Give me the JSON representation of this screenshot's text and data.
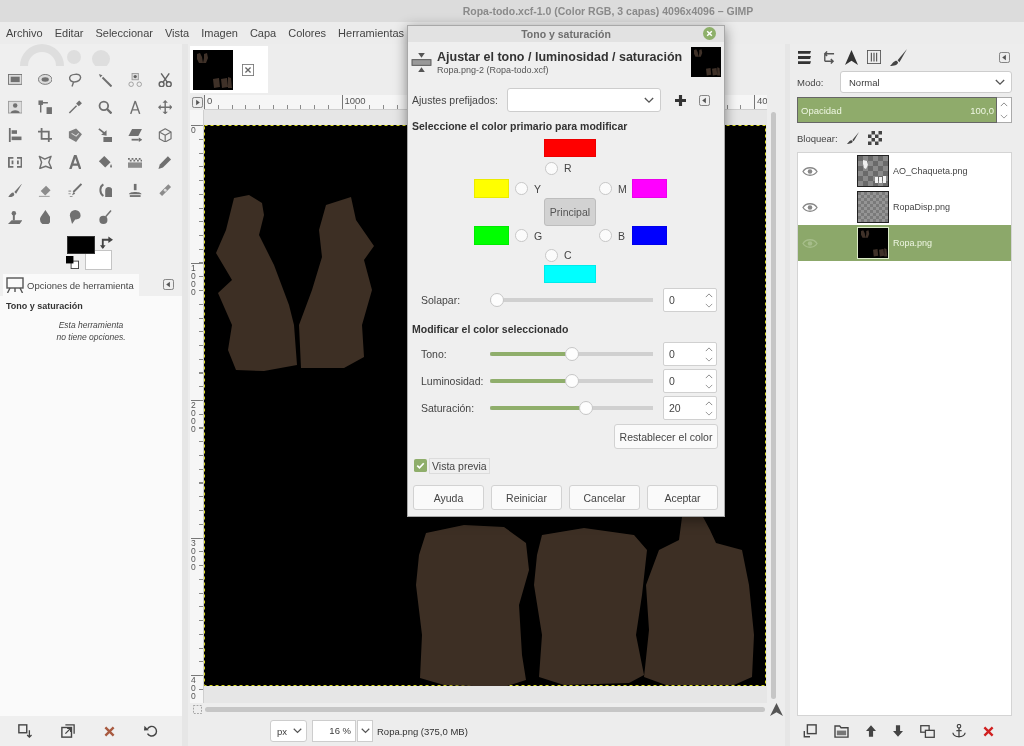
{
  "window": {
    "title": "Ropa-todo.xcf-1.0 (Color RGB, 3 capas) 4096x4096 – GIMP"
  },
  "menu": [
    "Archivo",
    "Editar",
    "Seleccionar",
    "Vista",
    "Imagen",
    "Capa",
    "Colores",
    "Herramientas"
  ],
  "tool_options": {
    "tab": "Opciones de herramienta",
    "tool": "Tono y saturación",
    "message": "Esta herramienta\nno tiene opciones."
  },
  "rulers": {
    "horizontal": [
      "0",
      "1000",
      "40"
    ],
    "vertical": [
      "0",
      "1000",
      "2000",
      "3000",
      "400"
    ]
  },
  "status_bar": {
    "unit": "px",
    "zoom": "16 %",
    "info": "Ropa.png (375,0 MB)"
  },
  "layers_panel": {
    "mode_label": "Modo:",
    "mode": "Normal",
    "opacity": {
      "label": "Opacidad",
      "reading": "100,0",
      "level": 1
    },
    "lock_label": "Bloquear:",
    "layers": [
      {
        "name": "AO_Chaqueta.png",
        "visible": true,
        "selected": false
      },
      {
        "name": "RopaDisp.png",
        "visible": true,
        "selected": false
      },
      {
        "name": "Ropa.png",
        "visible": true,
        "selected": true
      }
    ]
  },
  "dialog": {
    "title": "Tono y saturación",
    "heading": "Ajustar el tono / luminosidad / saturación",
    "subheading": "Ropa.png-2 (Ropa-todo.xcf)",
    "presets_label": "Ajustes prefijados:",
    "primary_heading": "Seleccione el color primario para modificar",
    "primaries": [
      {
        "label": "R",
        "color": "#ff0000",
        "selected": false
      },
      {
        "label": "Y",
        "color": "#ffff00",
        "selected": false
      },
      {
        "label": "M",
        "color": "#ff00ff",
        "selected": false
      },
      {
        "label": "G",
        "color": "#00ff00",
        "selected": false
      },
      {
        "label": "B",
        "color": "#0000ff",
        "selected": false
      },
      {
        "label": "C",
        "color": "#00ffff",
        "selected": false
      }
    ],
    "master": {
      "label": "Principal",
      "selected": true
    },
    "overlap": {
      "label": "Solapar:",
      "level": 0,
      "reading": "0"
    },
    "modify_heading": "Modificar el color seleccionado",
    "adjustments": [
      {
        "label": "Tono:",
        "level": 0.5,
        "reading": "0"
      },
      {
        "label": "Luminosidad:",
        "level": 0.5,
        "reading": "0"
      },
      {
        "label": "Saturación:",
        "level": 0.6,
        "reading": "20"
      }
    ],
    "reset_color": "Restablecer el color",
    "preview": {
      "label": "Vista previa",
      "checked": true
    },
    "buttons": [
      "Ayuda",
      "Reiniciar",
      "Cancelar",
      "Aceptar"
    ]
  }
}
